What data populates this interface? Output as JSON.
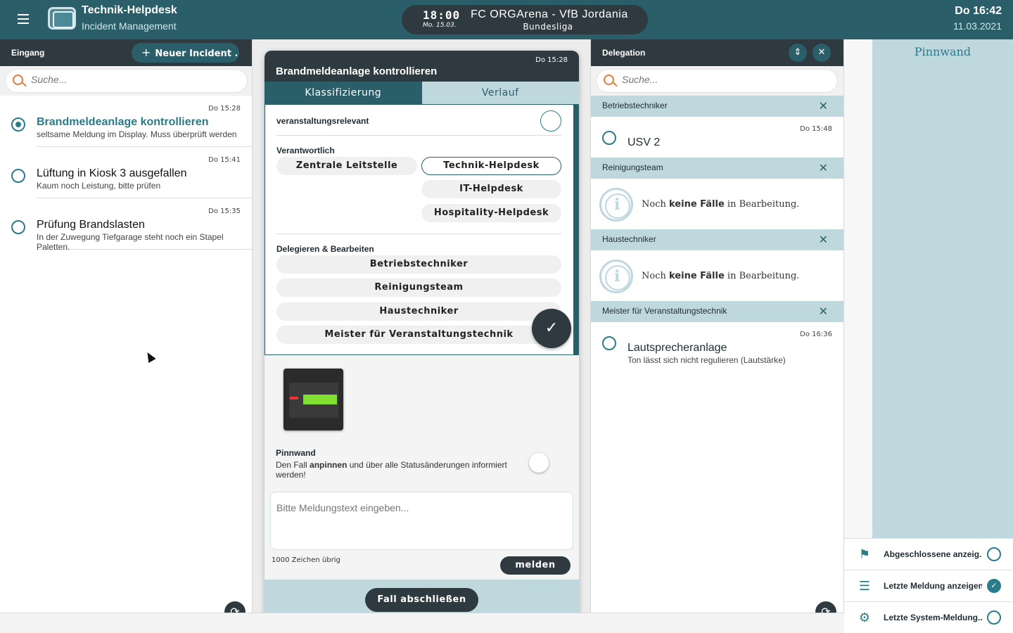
{
  "header": {
    "app_title": "Technik-Helpdesk",
    "app_subtitle": "Incident Management",
    "event_time": "18:00",
    "event_date": "Mo. 15.03.",
    "event_name": "FC ORGArena - VfB Jordania",
    "event_league": "Bundesliga",
    "clock_day": "Do 16:42",
    "clock_date": "11.03.2021"
  },
  "inbox": {
    "title": "Eingang",
    "new_button": "Neuer Incident ...",
    "search_placeholder": "Suche...",
    "items": [
      {
        "time": "Do 15:28",
        "title": "Brandmeldeanlage kontrollieren",
        "desc": "seltsame Meldung im Display. Muss überprüft werden",
        "selected": true
      },
      {
        "time": "Do 15:41",
        "title": "Lüftung in Kiosk 3 ausgefallen",
        "desc": "Kaum noch Leistung, bitte prüfen",
        "selected": false
      },
      {
        "time": "Do 15:35",
        "title": "Prüfung Brandslasten",
        "desc": "In der Zuwegung Tiefgarage steht noch ein Stapel Paletten.",
        "selected": false
      }
    ]
  },
  "detail": {
    "time": "Do 15:28",
    "title": "Brandmeldeanlage kontrollieren",
    "tabs": [
      "Klassifizierung",
      "Verlauf"
    ],
    "relevant_label": "veranstaltungsrelevant",
    "responsible_label": "Verantwortlich",
    "responsible": [
      "Zentrale Leitstelle",
      "Technik-Helpdesk",
      "IT-Helpdesk",
      "Hospitality-Helpdesk"
    ],
    "delegate_label": "Delegieren & Bearbeiten",
    "delegate": [
      "Betriebstechniker",
      "Reinigungsteam",
      "Haustechniker",
      "Meister für Veranstaltungstechnik"
    ],
    "pin_title": "Pinnwand",
    "pin_desc_pre": "Den Fall ",
    "pin_desc_bold": "anpinnen",
    "pin_desc_post": " und über alle Statusänderungen informiert werden!",
    "message_placeholder": "Bitte Meldungstext eingeben...",
    "chars_left": "1000 Zeichen übrig",
    "report_button": "melden",
    "close_button": "Fall abschließen"
  },
  "delegation": {
    "title": "Delegation",
    "search_placeholder": "Suche...",
    "groups": [
      {
        "name": "Betriebstechniker",
        "item": {
          "time": "Do 15:48",
          "title": "USV 2",
          "desc": ""
        }
      },
      {
        "name": "Reinigungsteam"
      },
      {
        "name": "Haustechniker"
      },
      {
        "name": "Meister für Veranstaltungstechnik",
        "item": {
          "time": "Do 16:36",
          "title": "Lautsprecheranlage",
          "desc": "Ton lässt sich nicht regulieren (Lautstärke)"
        }
      }
    ],
    "empty_pre": "Noch ",
    "empty_bold": "keine Fälle",
    "empty_post": " in Bearbeitung."
  },
  "pinboard": {
    "title": "Pinnwand",
    "options": [
      {
        "label": "Abgeschlossene anzeig...",
        "icon": "flag-icon",
        "checked": false
      },
      {
        "label": "Letzte Meldung anzeigen",
        "icon": "chat-icon",
        "checked": true
      },
      {
        "label": "Letzte System-Meldung...",
        "icon": "gear-icon",
        "checked": false
      }
    ]
  },
  "colors": {
    "header_bg": "#2a5f69",
    "dark": "#2e3a40",
    "accent": "#2a7c8a",
    "light_teal": "#bfd8de",
    "search_icon": "#e07a3a"
  }
}
